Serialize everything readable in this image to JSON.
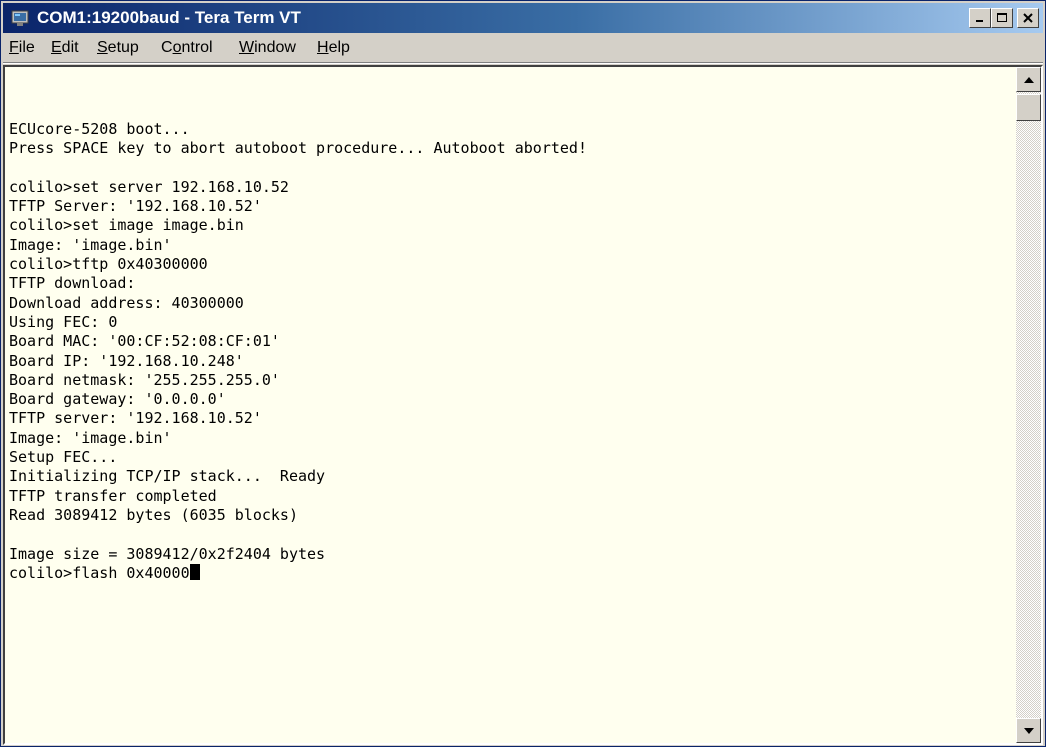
{
  "window": {
    "title": "COM1:19200baud - Tera Term VT",
    "title_icon": "tera-term-app-icon",
    "controls": [
      "minimize",
      "maximize",
      "close"
    ]
  },
  "menu": {
    "items": [
      {
        "label": "File",
        "mnemonic": "F"
      },
      {
        "label": "Edit",
        "mnemonic": "E"
      },
      {
        "label": "Setup",
        "mnemonic": "S"
      },
      {
        "label": "Control",
        "mnemonic": "o"
      },
      {
        "label": "Window",
        "mnemonic": "W"
      },
      {
        "label": "Help",
        "mnemonic": "H"
      }
    ]
  },
  "terminal": {
    "background": "#ffffef",
    "lines": [
      "ECUcore-5208 boot...",
      "Press SPACE key to abort autoboot procedure... Autoboot aborted!",
      "",
      "colilo>set server 192.168.10.52",
      "TFTP Server: '192.168.10.52'",
      "colilo>set image image.bin",
      "Image: 'image.bin'",
      "colilo>tftp 0x40300000",
      "TFTP download:",
      "Download address: 40300000",
      "Using FEC: 0",
      "Board MAC: '00:CF:52:08:CF:01'",
      "Board IP: '192.168.10.248'",
      "Board netmask: '255.255.255.0'",
      "Board gateway: '0.0.0.0'",
      "TFTP server: '192.168.10.52'",
      "Image: 'image.bin'",
      "Setup FEC...",
      "Initializing TCP/IP stack...  Ready",
      "TFTP transfer completed",
      "Read 3089412 bytes (6035 blocks)",
      "",
      "Image size = 3089412/0x2f2404 bytes",
      "colilo>flash 0x40000"
    ]
  },
  "scrollbar": {
    "position": 0
  }
}
